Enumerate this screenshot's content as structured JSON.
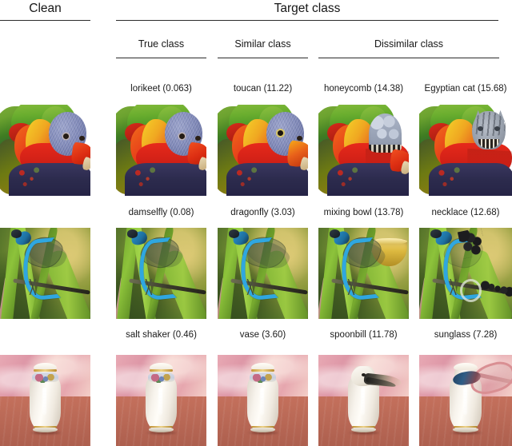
{
  "figure": {
    "headers": {
      "clean": "Clean",
      "target_class": "Target class"
    },
    "subheaders": {
      "true_class": "True class",
      "similar_class": "Similar class",
      "dissimilar_class": "Dissimilar class"
    },
    "columns": [
      "Clean",
      "True class",
      "Similar class",
      "Dissimilar class (a)",
      "Dissimilar class (b)"
    ],
    "rows": [
      {
        "id": "row-lorikeet",
        "clean_subject": "lorikeet",
        "captions": [
          "lorikeet (0.063)",
          "toucan (11.22)",
          "honeycomb (14.38)",
          "Egyptian cat (15.68)"
        ],
        "labels": [
          "lorikeet",
          "toucan",
          "honeycomb",
          "Egyptian cat"
        ],
        "values": [
          "0.063",
          "11.22",
          "14.38",
          "15.68"
        ]
      },
      {
        "id": "row-damselfly",
        "clean_subject": "damselfly",
        "captions": [
          "damselfly (0.08)",
          "dragonfly (3.03)",
          "mixing bowl (13.78)",
          "necklace (12.68)"
        ],
        "labels": [
          "damselfly",
          "dragonfly",
          "mixing bowl",
          "necklace"
        ],
        "values": [
          "0.08",
          "3.03",
          "13.78",
          "12.68"
        ]
      },
      {
        "id": "row-saltshaker",
        "clean_subject": "salt shaker",
        "captions": [
          "salt shaker (0.46)",
          "vase (3.60)",
          "spoonbill (11.78)",
          "sunglass (7.28)"
        ],
        "labels": [
          "salt shaker",
          "vase",
          "spoonbill",
          "sunglass"
        ],
        "values": [
          "0.46",
          "3.60",
          "11.78",
          "7.28"
        ]
      }
    ],
    "colors": {
      "rule": "#2b2b2b",
      "text": "#161616",
      "background": "#ffffff"
    }
  }
}
